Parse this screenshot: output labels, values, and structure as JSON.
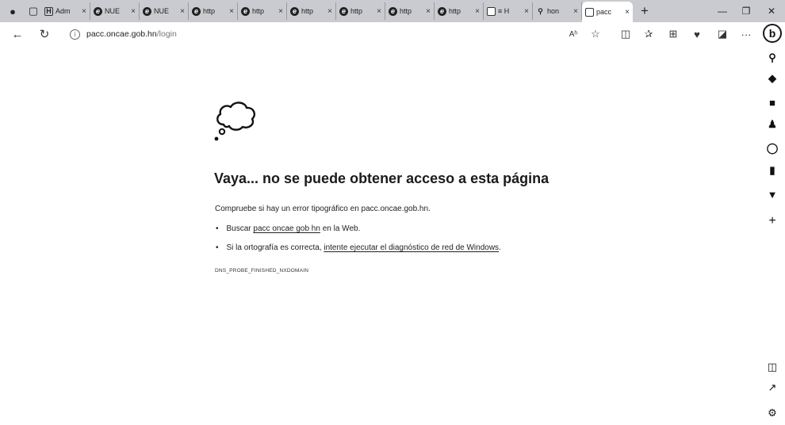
{
  "tabs": [
    {
      "label": "Adm",
      "favicon": "h-icon"
    },
    {
      "label": "NUE",
      "favicon": "edge-icon"
    },
    {
      "label": "NUE",
      "favicon": "edge-icon"
    },
    {
      "label": "http",
      "favicon": "edge-icon"
    },
    {
      "label": "http",
      "favicon": "edge-icon"
    },
    {
      "label": "http",
      "favicon": "edge-icon"
    },
    {
      "label": "http",
      "favicon": "edge-icon"
    },
    {
      "label": "http",
      "favicon": "edge-icon"
    },
    {
      "label": "http",
      "favicon": "edge-icon"
    },
    {
      "label": "≡ H",
      "favicon": "page-icon"
    },
    {
      "label": "hon",
      "favicon": "search-icon"
    },
    {
      "label": "pacc",
      "favicon": "document-icon"
    }
  ],
  "tab_close": "×",
  "new_tab": "+",
  "address": {
    "host": "pacc.oncae.gob.hn",
    "path": "/login"
  },
  "error": {
    "title": "Vaya... no se puede obtener acceso a esta página",
    "subtitle": "Compruebe si hay un error tipográfico en pacc.oncae.gob.hn.",
    "bullet1_prefix": "Buscar",
    "bullet1_link": "pacc oncae gob hn",
    "bullet1_suffix": "en la Web.",
    "bullet2_prefix": "Si la ortografía es correcta,",
    "bullet2_link": "intente ejecutar el diagnóstico de red de Windows",
    "bullet2_suffix": ".",
    "code": "DNS_PROBE_FINISHED_NXDOMAIN"
  },
  "toolbar": {
    "read_aloud": "Aʰ",
    "more": "···",
    "bing": "b"
  }
}
